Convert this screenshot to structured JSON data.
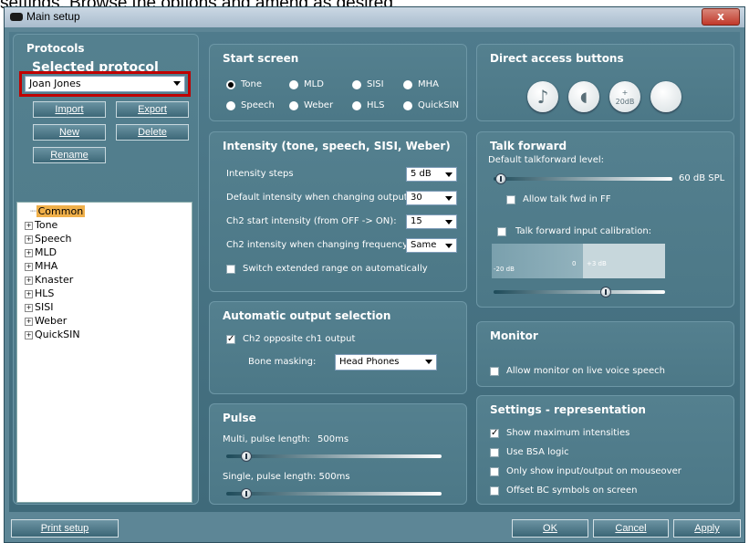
{
  "caption": "settings. Browse the options and amend as desired.",
  "window": {
    "title": "Main setup",
    "close": "x"
  },
  "protocols": {
    "title": "Protocols",
    "selected_label": "Selected protocol",
    "selected_value": "Joan Jones",
    "buttons": {
      "import": "Import",
      "export": "Export",
      "new": "New",
      "delete": "Delete",
      "rename": "Rename"
    },
    "tree": [
      "Common",
      "Tone",
      "Speech",
      "MLD",
      "MHA",
      "Knaster",
      "HLS",
      "SISI",
      "Weber",
      "QuickSIN"
    ]
  },
  "start_screen": {
    "title": "Start screen",
    "options": [
      "Tone",
      "MLD",
      "SISI",
      "MHA",
      "Speech",
      "Weber",
      "HLS",
      "QuickSIN"
    ],
    "selected": "Tone"
  },
  "intensity": {
    "title": "Intensity (tone, speech, SISI, Weber)",
    "rows": [
      {
        "label": "Intensity steps",
        "value": "5 dB"
      },
      {
        "label": "Default intensity when changing output:",
        "value": "30"
      },
      {
        "label": "Ch2 start intensity (from OFF -> ON):",
        "value": "15"
      },
      {
        "label": "Ch2 intensity when changing frequency:",
        "value": "Same"
      }
    ],
    "extended_range": "Switch extended range on automatically"
  },
  "auto_output": {
    "title": "Automatic output selection",
    "ch2_opposite": "Ch2 opposite ch1 output",
    "bone_masking_label": "Bone masking:",
    "bone_masking_value": "Head Phones"
  },
  "pulse": {
    "title": "Pulse",
    "multi_label": "Multi, pulse length:",
    "multi_value": "500ms",
    "single_label": "Single, pulse length: 500ms"
  },
  "direct_access": {
    "title": "Direct access buttons",
    "buttons": [
      "music-note-icon",
      "speech-head-icon",
      "plus-20db-icon",
      "blank-icon"
    ],
    "plus_label": "20dB"
  },
  "talk_forward": {
    "title": "Talk forward",
    "default_label": "Default talkforward level:",
    "level": "60 dB SPL",
    "allow_ff": "Allow talk fwd in FF",
    "calibration": "Talk forward input calibration:",
    "scale_min": "-20 dB",
    "scale_zero": "0",
    "scale_max": "+3 dB"
  },
  "monitor": {
    "title": "Monitor",
    "allow_live": "Allow monitor on live voice speech"
  },
  "representation": {
    "title": "Settings - representation",
    "options": [
      {
        "label": "Show maximum intensities",
        "checked": true
      },
      {
        "label": "Use BSA logic",
        "checked": false
      },
      {
        "label": "Only show input/output on mouseover",
        "checked": false
      },
      {
        "label": "Offset BC symbols on screen",
        "checked": false
      }
    ]
  },
  "footer": {
    "print_setup": "Print setup",
    "ok": "OK",
    "cancel": "Cancel",
    "apply": "Apply"
  },
  "colors": {
    "panel": "#4f7b8c",
    "highlight_box": "#c00000",
    "tree_selected": "#f0b04a"
  }
}
